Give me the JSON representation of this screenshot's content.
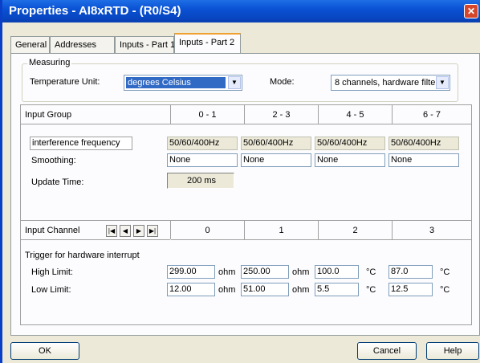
{
  "window": {
    "title": "Properties - AI8xRTD - (R0/S4)",
    "close_glyph": "✕"
  },
  "tabs": [
    "General",
    "Addresses",
    "Inputs - Part 1",
    "Inputs - Part 2"
  ],
  "measuring": {
    "group_title": "Measuring",
    "temperature_unit_label": "Temperature Unit:",
    "temperature_unit_value": "degrees Celsius",
    "mode_label": "Mode:",
    "mode_value": "8 channels, hardware filte"
  },
  "input_group": {
    "header_label": "Input Group",
    "columns": [
      "0 - 1",
      "2 - 3",
      "4 - 5",
      "6 - 7"
    ],
    "interference_label": "interference frequency",
    "interference_values": [
      "50/60/400Hz",
      "50/60/400Hz",
      "50/60/400Hz",
      "50/60/400Hz"
    ],
    "smoothing_label": "Smoothing:",
    "smoothing_values": [
      "None",
      "None",
      "None",
      "None"
    ],
    "update_time_label": "Update Time:",
    "update_time_value": "200 ms"
  },
  "input_channel": {
    "header_label": "Input Channel",
    "nav_icons": [
      "first-icon",
      "prev-icon",
      "next-icon",
      "last-icon"
    ],
    "nav_glyphs": [
      "|◀",
      "◀",
      "▶",
      "▶|"
    ],
    "columns": [
      "0",
      "1",
      "2",
      "3"
    ],
    "trigger_label": "Trigger for hardware interrupt",
    "high_limit_label": "High Limit:",
    "low_limit_label": "Low Limit:",
    "high_limits": [
      {
        "value": "299.00",
        "unit": "ohm"
      },
      {
        "value": "250.00",
        "unit": "ohm"
      },
      {
        "value": "100.0",
        "unit": "°C"
      },
      {
        "value": "87.0",
        "unit": "°C"
      }
    ],
    "low_limits": [
      {
        "value": "12.00",
        "unit": "ohm"
      },
      {
        "value": "51.00",
        "unit": "ohm"
      },
      {
        "value": "5.5",
        "unit": "°C"
      },
      {
        "value": "12.5",
        "unit": "°C"
      }
    ]
  },
  "buttons": {
    "ok": "OK",
    "cancel": "Cancel",
    "help": "Help"
  }
}
